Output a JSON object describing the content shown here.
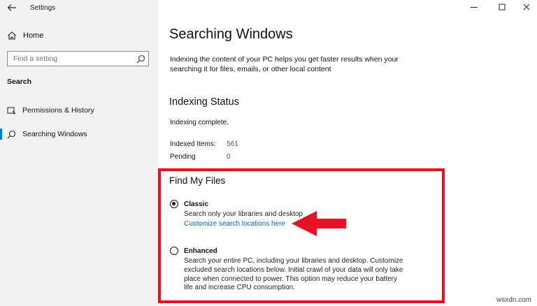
{
  "window": {
    "title": "Settings",
    "back_icon": "back-arrow-icon",
    "controls": [
      "minimize-icon",
      "maximize-icon",
      "close-icon"
    ]
  },
  "sidebar": {
    "home_label": "Home",
    "search_placeholder": "Find a setting",
    "section_label": "Search",
    "items": [
      {
        "label": "Permissions & History",
        "icon": "permissions-icon",
        "active": false
      },
      {
        "label": "Searching Windows",
        "icon": "search-icon",
        "active": true
      }
    ]
  },
  "main": {
    "title": "Searching Windows",
    "description": "Indexing the content of your PC helps you get faster results when your searching it for files, emails, or other local content",
    "indexing": {
      "heading": "Indexing Status",
      "status": "Indexing complete.",
      "indexed_label": "Indexed Items:",
      "indexed_value": "561",
      "pending_label": "Pending",
      "pending_value": "0"
    },
    "find_files": {
      "heading": "Find My Files",
      "classic": {
        "title": "Classic",
        "desc": "Search only your libraries and desktop",
        "link": "Customize search locations here",
        "selected": true
      },
      "enhanced": {
        "title": "Enhanced",
        "desc": "Search your entire PC, including your libraries and desktop. Customize excluded search locations below. Initial crawl of your data will only take place when connected to power. This option may reduce your battery life and increase CPU consumption.",
        "selected": false
      }
    }
  },
  "annotation": {
    "highlight_color": "#e81123",
    "arrow_color": "#e81123"
  },
  "watermark": "wsxdn.com",
  "colors": {
    "accent": "#0078d7",
    "link": "#0067b8",
    "sidebar_bg": "#f2f2f2"
  }
}
